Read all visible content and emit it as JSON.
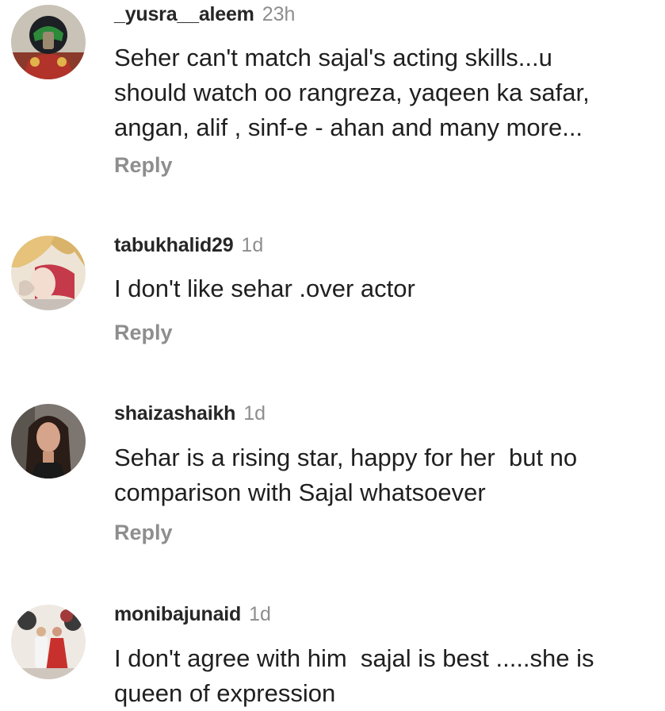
{
  "comments": [
    {
      "username": "_yusra__aleem",
      "time": "23h",
      "avatar_icon": "helmet-profile-avatar",
      "lines": [
        "Seher can't match sajal's acting skills...u",
        "should watch oo rangreza, yaqeen ka safar,",
        "angan, alif , sinf-e - ahan and many more..."
      ],
      "reply_label": "Reply"
    },
    {
      "username": "tabukhalid29",
      "time": "1d",
      "avatar_icon": "painted-profile-avatar",
      "lines": [
        "I don't like sehar .over actor"
      ],
      "reply_label": "Reply"
    },
    {
      "username": "shaizashaikh",
      "time": "1d",
      "avatar_icon": "woman-photo-avatar",
      "lines": [
        "Sehar is a rising star, happy for her  but no",
        "comparison with Sajal whatsoever"
      ],
      "reply_label": "Reply"
    },
    {
      "username": "monibajunaid",
      "time": "1d",
      "avatar_icon": "couple-photo-avatar",
      "lines": [
        "I don't agree with him  sajal is best .....she is",
        "queen of expression"
      ]
    }
  ]
}
